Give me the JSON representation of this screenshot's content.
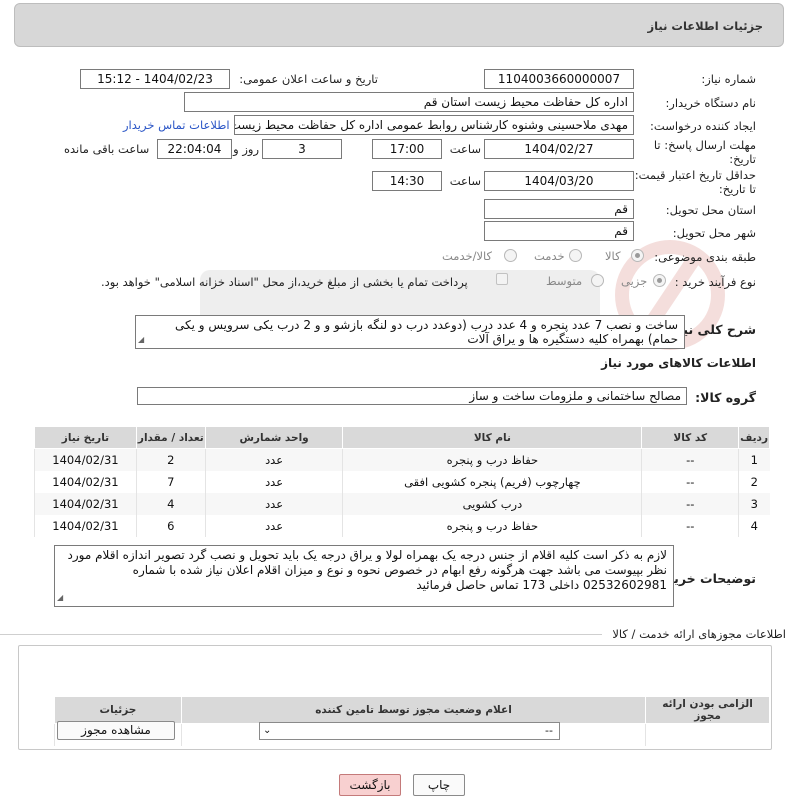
{
  "header": {
    "title": "جزئیات اطلاعات نیاز"
  },
  "fields": {
    "need_number_label": "شماره نیاز:",
    "need_number": "1104003660000007",
    "announce_label": "تاریخ و ساعت اعلان عمومی:",
    "announce_value": "1404/02/23 - 15:12",
    "buyer_org_label": "نام دستگاه خریدار:",
    "buyer_org": "اداره کل حفاظت محیط زیست استان قم",
    "requester_label": "ایجاد کننده درخواست:",
    "requester": "مهدی ملاحسینی وشنوه کارشناس روابط عمومی اداره کل حفاظت محیط زیست",
    "buyer_contact_link": "اطلاعات تماس خریدار",
    "deadline_label_1": "مهلت ارسال پاسخ: تا",
    "deadline_label_2": "تاریخ:",
    "deadline_date": "1404/02/27",
    "time_label": "ساعت",
    "deadline_time": "17:00",
    "days_value": "3",
    "days_and_label": "روز و",
    "remaining_time": "22:04:04",
    "remaining_label": "ساعت باقی مانده",
    "min_price_label_1": "حداقل تاریخ اعتبار قیمت:",
    "min_price_label_2": "تا تاریخ:",
    "min_price_date": "1404/03/20",
    "min_price_time": "14:30",
    "province_label": "استان محل تحویل:",
    "province": "قم",
    "city_label": "شهر محل تحویل:",
    "city": "قم",
    "category_label": "طبقه بندی موضوعی:",
    "category_options": [
      "کالا",
      "خدمت",
      "کالا/خدمت"
    ],
    "process_label": "نوع فرآیند خرید :",
    "process_options": [
      "جزیی",
      "متوسط"
    ],
    "payment_note": "پرداخت تمام یا بخشی از مبلغ خرید،از محل \"اسناد خزانه اسلامی\" خواهد بود.",
    "summary_label": "شرح کلی نیاز:",
    "summary": "ساخت و نصب 7 عدد پنجره و 4 عدد درب (دوعدد درب دو لنگه بازشو و و 2 درب  یکی سرویس و یکی حمام) بهمراه کلیه دستگیره ها و یراق آلات",
    "goods_info_title": "اطلاعات کالاهای مورد نیاز",
    "goods_group_label": "گروه کالا:",
    "goods_group": "مصالح ساختمانی و ملزومات ساخت و ساز"
  },
  "goods_table": {
    "headers": [
      "ردیف",
      "کد کالا",
      "نام کالا",
      "واحد شمارش",
      "تعداد / مقدار",
      "تاریخ نیاز"
    ],
    "rows": [
      [
        "1",
        "--",
        "حفاظ درب و پنجره",
        "عدد",
        "2",
        "1404/02/31"
      ],
      [
        "2",
        "--",
        "چهارچوب (فریم) پنجره کشویی افقی",
        "عدد",
        "7",
        "1404/02/31"
      ],
      [
        "3",
        "--",
        "درب کشویی",
        "عدد",
        "4",
        "1404/02/31"
      ],
      [
        "4",
        "--",
        "حفاظ درب و پنجره",
        "عدد",
        "6",
        "1404/02/31"
      ]
    ]
  },
  "buyer_notes": {
    "label": "توضیحات خریدار:",
    "text": "لازم به ذکر است کلیه اقلام از جنس درجه یک بهمراه لولا و یراق درجه یک باید تحویل و نصب گرد تصویر اندازه اقلام مورد نظر بپیوست می باشد جهت هرگونه رفع ابهام در خصوص نحوه و نوع و میزان اقلام اعلان نیاز شده با شماره 02532602981 داخلی 173 تماس حاصل فرمائید"
  },
  "permits": {
    "title": "اطلاعات مجوزهای ارائه خدمت / کالا",
    "headers": [
      "الزامی بودن ارائه مجوز",
      "اعلام وضعیت مجوز توسط تامین کننده",
      "جزئیات"
    ],
    "select_value": "--",
    "view_button": "مشاهده مجوز"
  },
  "actions": {
    "print": "چاپ",
    "back": "بازگشت"
  },
  "colors": {
    "link": "#2a55c6",
    "header_bg": "#d7d7d7",
    "back_button": "#f8d0d0"
  }
}
